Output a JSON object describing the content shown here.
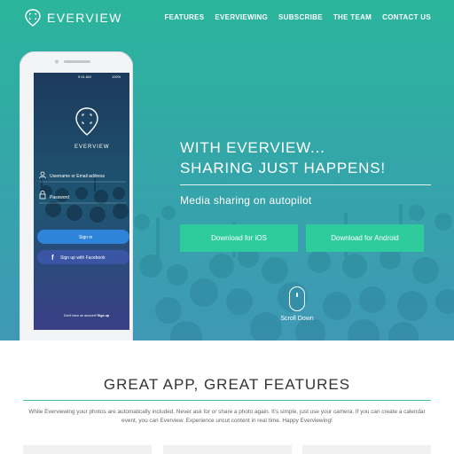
{
  "brand": {
    "name": "EVERVIEW",
    "accent": "#2ecc9d"
  },
  "nav": {
    "items": [
      {
        "label": "FEATURES"
      },
      {
        "label": "EVERVIEWING"
      },
      {
        "label": "SUBSCRIBE"
      },
      {
        "label": "THE TEAM"
      },
      {
        "label": "CONTACT US"
      }
    ]
  },
  "hero": {
    "headline_line1": "WITH EVERVIEW...",
    "headline_line2": "SHARING JUST HAPPENS!",
    "subheadline": "Media sharing on autopilot",
    "download_ios": "Download for iOS",
    "download_android": "Download for Android",
    "scroll_label": "Scroll Down"
  },
  "phone": {
    "status_time": "9:41 AM",
    "status_battery": "100%",
    "app_name": "EVERVIEW",
    "username_placeholder": "Username or Email address",
    "password_placeholder": "Password",
    "sign_in": "Sign in",
    "facebook_label": "Sign up with Facebook",
    "no_account_text": "Don't have an account?",
    "sign_up_link": "Sign up"
  },
  "features": {
    "title": "GREAT APP, GREAT FEATURES",
    "description": "While Everviewing your photos are automatically included. Never ask for or share a photo again. It's simple, just use your camera. If you can create a calendar event, you can Everview. Experience uncut content in real time. Happy Everviewing!"
  },
  "icons": {
    "logo": "location-pin-icon",
    "scroll": "mouse-icon",
    "facebook": "facebook-icon",
    "user": "user-icon",
    "lock": "lock-icon"
  }
}
